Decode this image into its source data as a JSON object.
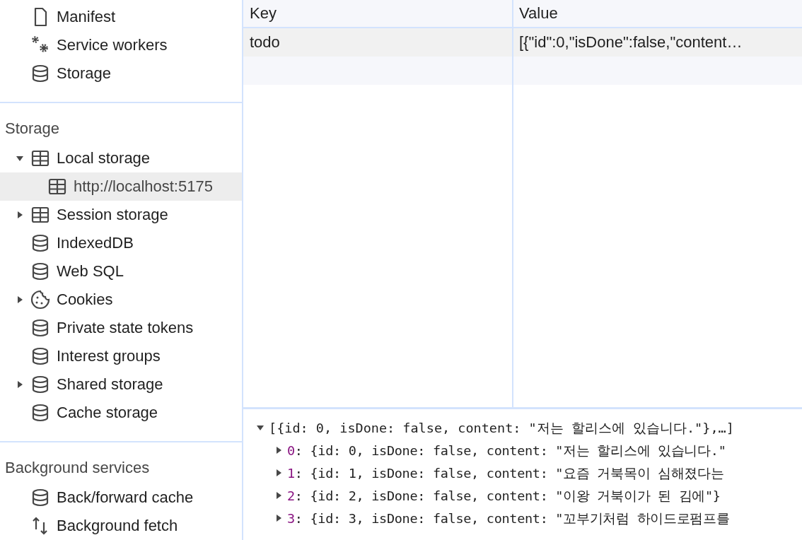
{
  "sidebar": {
    "sections": [
      {
        "items": [
          {
            "label": "Manifest",
            "kind": "document",
            "selected": false
          },
          {
            "label": "Service workers",
            "kind": "gears",
            "selected": false
          },
          {
            "label": "Storage",
            "kind": "database",
            "selected": false
          }
        ]
      },
      {
        "title": "Storage",
        "items": [
          {
            "label": "Local storage",
            "kind": "table",
            "selected": false,
            "expanded": true,
            "children": [
              {
                "label": "http://localhost:5175",
                "kind": "table",
                "selected": true
              }
            ]
          },
          {
            "label": "Session storage",
            "kind": "table",
            "selected": false,
            "expanded": false
          },
          {
            "label": "IndexedDB",
            "kind": "database",
            "selected": false
          },
          {
            "label": "Web SQL",
            "kind": "database",
            "selected": false
          },
          {
            "label": "Cookies",
            "kind": "cookie",
            "selected": false,
            "expanded": false
          },
          {
            "label": "Private state tokens",
            "kind": "database",
            "selected": false
          },
          {
            "label": "Interest groups",
            "kind": "database",
            "selected": false
          },
          {
            "label": "Shared storage",
            "kind": "database",
            "selected": false,
            "expanded": false
          },
          {
            "label": "Cache storage",
            "kind": "database",
            "selected": false
          }
        ]
      },
      {
        "title": "Background services",
        "items": [
          {
            "label": "Back/forward cache",
            "kind": "database",
            "selected": false
          },
          {
            "label": "Background fetch",
            "kind": "arrows",
            "selected": false
          }
        ]
      }
    ]
  },
  "table": {
    "columns": [
      "Key",
      "Value"
    ],
    "rows": [
      {
        "cells": [
          "todo",
          "[{\"id\":0,\"isDone\":false,\"content…"
        ],
        "selected": true
      }
    ]
  },
  "preview": {
    "summary": "[{id: 0, isDone: false, content: \"저는 할리스에 있습니다.\"},…]",
    "expanded": true,
    "entries": [
      {
        "index": "0",
        "text": ": {id: 0, isDone: false, content: \"저는 할리스에 있습니다.\"",
        "expanded": false
      },
      {
        "index": "1",
        "text": ": {id: 1, isDone: false, content: \"요즘 거북목이 심해졌다는",
        "expanded": false
      },
      {
        "index": "2",
        "text": ": {id: 2, isDone: false, content: \"이왕 거북이가 된 김에\"}",
        "expanded": false
      },
      {
        "index": "3",
        "text": ": {id: 3, isDone: false, content: \"꼬부기처럼 하이드로펌프를",
        "expanded": false
      }
    ]
  }
}
